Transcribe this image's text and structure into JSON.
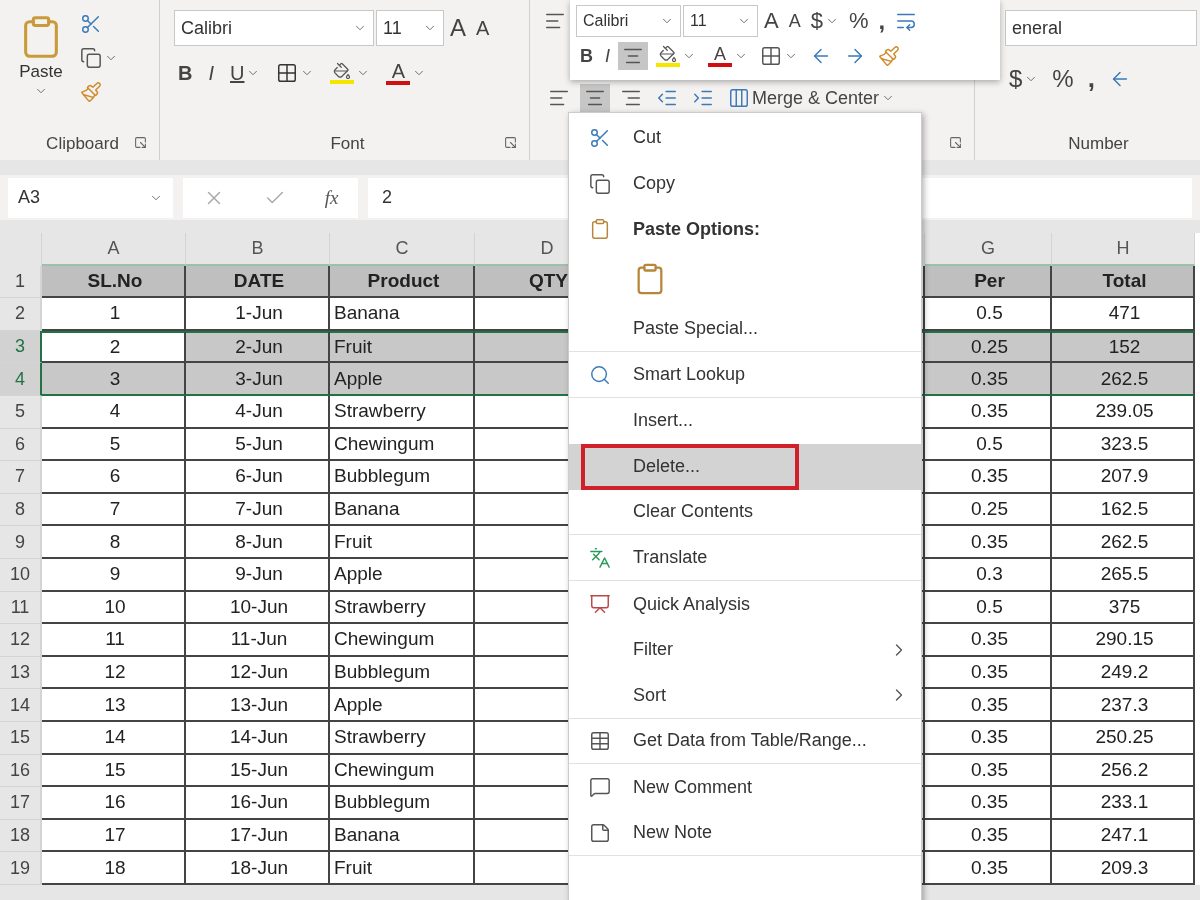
{
  "ribbon": {
    "clipboard": {
      "paste_label": "Paste",
      "group_label": "Clipboard"
    },
    "font": {
      "font_name": "Calibri",
      "font_size": "11",
      "grow": "A",
      "shrink": "A",
      "bold": "B",
      "italic": "I",
      "underline": "U",
      "font_color": "A",
      "group_label": "Font"
    },
    "alignment": {
      "merge_label": "Merge & Center",
      "center_selected": true
    },
    "number": {
      "format": "eneral",
      "currency": "$",
      "percent": "%",
      "comma": ",",
      "group_label": "Number"
    }
  },
  "mini_toolbar": {
    "font_name": "Calibri",
    "font_size": "11",
    "grow": "A",
    "shrink": "A",
    "currency": "$",
    "percent": "%",
    "comma": ",",
    "bold": "B",
    "italic": "I",
    "center_selected": true,
    "font_color": "A"
  },
  "formula_bar": {
    "name_box": "A3",
    "fx": "fx",
    "value": "2"
  },
  "sheet": {
    "columns": [
      "A",
      "B",
      "C",
      "D",
      "G",
      "H"
    ],
    "header_row": {
      "number": "1",
      "cells": [
        "SL.No",
        "DATE",
        "Product",
        "QTY",
        "Per",
        "Total"
      ]
    },
    "rows": [
      {
        "number": "2",
        "sl": "1",
        "date": "1-Jun",
        "product": "Banana",
        "per": "0.5",
        "total": "471",
        "selected": false,
        "active": false
      },
      {
        "number": "3",
        "sl": "2",
        "date": "2-Jun",
        "product": "Fruit",
        "per": "0.25",
        "total": "152",
        "selected": true,
        "active": true
      },
      {
        "number": "4",
        "sl": "3",
        "date": "3-Jun",
        "product": "Apple",
        "per": "0.35",
        "total": "262.5",
        "selected": true,
        "active": false
      },
      {
        "number": "5",
        "sl": "4",
        "date": "4-Jun",
        "product": "Strawberry",
        "per": "0.35",
        "total": "239.05",
        "selected": false,
        "active": false
      },
      {
        "number": "6",
        "sl": "5",
        "date": "5-Jun",
        "product": "Chewingum",
        "per": "0.5",
        "total": "323.5",
        "selected": false,
        "active": false
      },
      {
        "number": "7",
        "sl": "6",
        "date": "6-Jun",
        "product": "Bubblegum",
        "per": "0.35",
        "total": "207.9",
        "selected": false,
        "active": false
      },
      {
        "number": "8",
        "sl": "7",
        "date": "7-Jun",
        "product": "Banana",
        "per": "0.25",
        "total": "162.5",
        "selected": false,
        "active": false
      },
      {
        "number": "9",
        "sl": "8",
        "date": "8-Jun",
        "product": "Fruit",
        "per": "0.35",
        "total": "262.5",
        "selected": false,
        "active": false
      },
      {
        "number": "10",
        "sl": "9",
        "date": "9-Jun",
        "product": "Apple",
        "per": "0.3",
        "total": "265.5",
        "selected": false,
        "active": false
      },
      {
        "number": "11",
        "sl": "10",
        "date": "10-Jun",
        "product": "Strawberry",
        "per": "0.5",
        "total": "375",
        "selected": false,
        "active": false
      },
      {
        "number": "12",
        "sl": "11",
        "date": "11-Jun",
        "product": "Chewingum",
        "per": "0.35",
        "total": "290.15",
        "selected": false,
        "active": false
      },
      {
        "number": "13",
        "sl": "12",
        "date": "12-Jun",
        "product": "Bubblegum",
        "per": "0.35",
        "total": "249.2",
        "selected": false,
        "active": false
      },
      {
        "number": "14",
        "sl": "13",
        "date": "13-Jun",
        "product": "Apple",
        "per": "0.35",
        "total": "237.3",
        "selected": false,
        "active": false
      },
      {
        "number": "15",
        "sl": "14",
        "date": "14-Jun",
        "product": "Strawberry",
        "per": "0.35",
        "total": "250.25",
        "selected": false,
        "active": false
      },
      {
        "number": "16",
        "sl": "15",
        "date": "15-Jun",
        "product": "Chewingum",
        "per": "0.35",
        "total": "256.2",
        "selected": false,
        "active": false
      },
      {
        "number": "17",
        "sl": "16",
        "date": "16-Jun",
        "product": "Bubblegum",
        "per": "0.35",
        "total": "233.1",
        "selected": false,
        "active": false
      },
      {
        "number": "18",
        "sl": "17",
        "date": "17-Jun",
        "product": "Banana",
        "per": "0.35",
        "total": "247.1",
        "selected": false,
        "active": false
      },
      {
        "number": "19",
        "sl": "18",
        "date": "18-Jun",
        "product": "Fruit",
        "per": "0.35",
        "total": "209.3",
        "selected": false,
        "active": false
      }
    ]
  },
  "context_menu": {
    "items": [
      {
        "kind": "item",
        "label": "Cut",
        "separator_after": false
      },
      {
        "kind": "item",
        "label": "Copy",
        "separator_after": false
      },
      {
        "kind": "header",
        "label": "Paste Options:",
        "separator_after": false
      },
      {
        "kind": "paste-option",
        "separator_after": false
      },
      {
        "kind": "item",
        "label": "Paste Special...",
        "separator_after": true
      },
      {
        "kind": "item",
        "label": "Smart Lookup",
        "separator_after": true
      },
      {
        "kind": "item",
        "label": "Insert...",
        "separator_after": false
      },
      {
        "kind": "item",
        "label": "Delete...",
        "separator_after": false,
        "highlighted": true,
        "annotated": true
      },
      {
        "kind": "item",
        "label": "Clear Contents",
        "separator_after": true
      },
      {
        "kind": "item",
        "label": "Translate",
        "separator_after": true
      },
      {
        "kind": "item",
        "label": "Quick Analysis",
        "separator_after": false
      },
      {
        "kind": "submenu",
        "label": "Filter",
        "separator_after": false
      },
      {
        "kind": "submenu",
        "label": "Sort",
        "separator_after": true
      },
      {
        "kind": "item",
        "label": "Get Data from Table/Range...",
        "separator_after": true
      },
      {
        "kind": "item",
        "label": "New Comment",
        "separator_after": false
      },
      {
        "kind": "item",
        "label": "New Note",
        "separator_after": true
      }
    ]
  }
}
